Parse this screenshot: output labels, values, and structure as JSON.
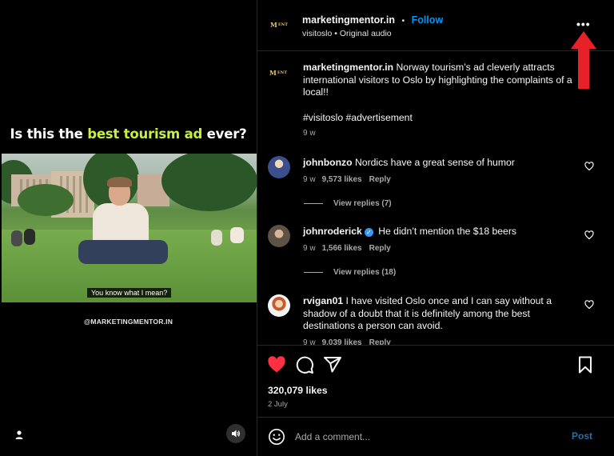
{
  "video": {
    "headline_pre": "Is this the ",
    "headline_hl": "best tourism ad",
    "headline_post": " ever?",
    "subtitle": "You know what I mean?",
    "watermark": "@MARKETINGMENTOR.IN",
    "sound_icon": "speaker-icon",
    "user_icon": "person-icon"
  },
  "header": {
    "avatar_text": "M",
    "avatar_sub": "ENT",
    "username": "marketingmentor.in",
    "separator": "•",
    "follow": "Follow",
    "audio": "visitoslo • Original audio",
    "more": "•••"
  },
  "caption": {
    "username": "marketingmentor.in",
    "text": "Norway tourism’s ad cleverly attracts international visitors to Oslo by highlighting the complaints of a local!!",
    "hashtags": "#visitoslo #advertisement",
    "age": "9 w"
  },
  "comments": [
    {
      "username": "johnbonzo",
      "verified": false,
      "text": "Nordics have a great sense of humor",
      "age": "9 w",
      "likes": "9,573 likes",
      "reply": "Reply",
      "view_replies": "View replies (7)"
    },
    {
      "username": "johnroderick",
      "verified": true,
      "text": "He didn’t mention the $18 beers",
      "age": "9 w",
      "likes": "1,566 likes",
      "reply": "Reply",
      "view_replies": "View replies (18)"
    },
    {
      "username": "rvigan01",
      "verified": false,
      "text": "I have visited Oslo once and I can say without a shadow of a doubt that it is definitely among the best destinations a person can avoid.",
      "age": "9 w",
      "likes": "9,039 likes",
      "reply": "Reply"
    }
  ],
  "actions": {
    "like_icon": "heart-filled-icon",
    "comment_icon": "comment-bubble-icon",
    "share_icon": "paper-plane-icon",
    "save_icon": "bookmark-icon",
    "likes": "320,079 likes",
    "date": "2 July"
  },
  "comment_box": {
    "placeholder": "Add a comment...",
    "post": "Post"
  },
  "colors": {
    "accent_green": "#c6f03c",
    "follow_blue": "#0095f6",
    "like_red": "#ff3040",
    "arrow_red": "#e8202a"
  }
}
